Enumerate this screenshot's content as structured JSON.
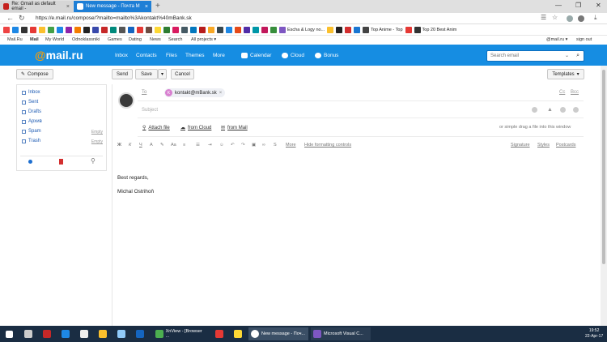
{
  "browser": {
    "tabs": [
      {
        "title": "Re: Gmail as default email -"
      },
      {
        "title": "New message - Почта M"
      }
    ],
    "url": "https://e.mail.ru/compose/?mailto=mailto%3Akontakt%40mBank.sk"
  },
  "bookmarks": [
    {
      "label": "Escha & Logy no..."
    },
    {
      "label": "Top Anime - Top"
    },
    {
      "label": "Top 20 Best Anim"
    }
  ],
  "portal": {
    "links": [
      "Mail.Ru",
      "Mail",
      "My World",
      "Odnoklassniki",
      "Games",
      "Dating",
      "News",
      "Search",
      "All projects ▾"
    ],
    "account": "@mail.ru ▾",
    "signout": "sign out"
  },
  "header": {
    "logo_at": "@",
    "logo_text": "mail.ru",
    "nav": [
      "Inbox",
      "Contacts",
      "Files",
      "Themes",
      "More"
    ],
    "services": [
      "Calendar",
      "Cloud",
      "Bonus"
    ],
    "search_placeholder": "Search email"
  },
  "toolbar": {
    "compose": "Compose",
    "send": "Send",
    "save": "Save",
    "cancel": "Cancel",
    "templates": "Templates"
  },
  "sidebar": {
    "folders": [
      {
        "label": "Inbox",
        "action": ""
      },
      {
        "label": "Sent",
        "action": ""
      },
      {
        "label": "Drafts",
        "action": ""
      },
      {
        "label": "Архив",
        "action": ""
      },
      {
        "label": "Spam",
        "action": "Empty"
      },
      {
        "label": "Trash",
        "action": "Empty"
      }
    ]
  },
  "compose": {
    "to_label": "To",
    "recipient_initial": "K",
    "recipient": "kontakt@mBank.sk",
    "cc": "Cc",
    "bcc": "Bcc",
    "subject_placeholder": "Subject",
    "attach_file": "Attach file",
    "from_cloud": "from Cloud",
    "from_mail": "from Mail",
    "drag_hint": "or simple drag a file into this window",
    "more": "More",
    "hide_formatting": "Hide formatting controls",
    "signature": "Signature",
    "styles": "Styles",
    "postcards": "Postcards",
    "body_line1": "Best regards,",
    "body_line2": "Michal Ostrihoň"
  },
  "taskbar": {
    "apps": [
      {
        "label": "XnView - [Browser ..."
      },
      {
        "label": "New message - Поч..."
      },
      {
        "label": "Microsoft Visual C..."
      }
    ],
    "time": "19:52",
    "date": "22-Apr-17"
  }
}
